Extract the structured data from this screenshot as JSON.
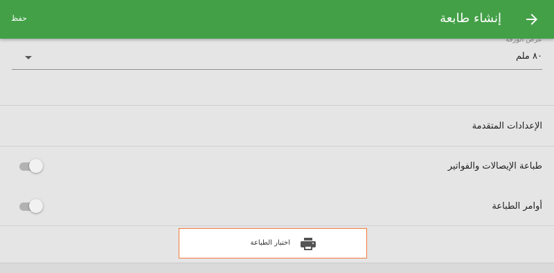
{
  "appbar": {
    "title": "إنشاء طابعة",
    "save_label": "حفظ",
    "back_icon": "arrow-right-icon",
    "background_color": "#43a047"
  },
  "paper": {
    "label": "عرض الورقة",
    "value": "٨٠ ملم"
  },
  "sections": {
    "advanced_label": "الإعدادات المتقدمة",
    "print_receipts_label": "طباعة الإيصالات والفواتير",
    "print_receipts_enabled": false,
    "print_orders_label": "أوامر الطباعة",
    "print_orders_enabled": false
  },
  "test_button": {
    "label": "اختبار الطباعة",
    "icon": "printer-icon",
    "border_color": "#f0783a"
  }
}
